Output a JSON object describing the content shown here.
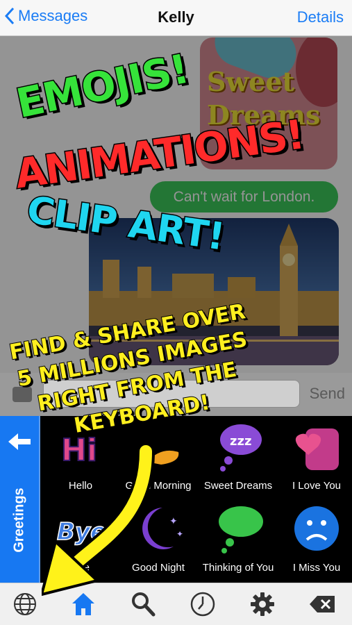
{
  "nav": {
    "back_label": "Messages",
    "title": "Kelly",
    "details_label": "Details"
  },
  "conversation": {
    "image_message_text": "Sweet Dreams",
    "text_message": "Can't wait for London."
  },
  "input_bar": {
    "send_label": "Send"
  },
  "keyboard": {
    "category": "Greetings",
    "tiles": [
      {
        "label": "Hello",
        "art": "Hi"
      },
      {
        "label": "Good Morning",
        "art": ""
      },
      {
        "label": "Sweet Dreams",
        "art": "zzz"
      },
      {
        "label": "I Love You",
        "art": ""
      },
      {
        "label": "Bye",
        "art": "Bye"
      },
      {
        "label": "Good Night",
        "art": ""
      },
      {
        "label": "Thinking of You",
        "art": ""
      },
      {
        "label": "I Miss You",
        "art": ""
      }
    ]
  },
  "toolbar": {
    "icons": [
      "globe-icon",
      "home-icon",
      "search-icon",
      "clock-icon",
      "gear-icon",
      "delete-icon"
    ]
  },
  "promo": {
    "line1": "EMOJIS!",
    "line2": "ANIMATIONS!",
    "line3": "CLIP ART!",
    "line4a": "FIND & SHARE OVER",
    "line4b": "5 MILLIONS IMAGES",
    "line4c": "RIGHT FROM THE",
    "line4d": "KEYBOARD!"
  },
  "colors": {
    "ios_blue": "#1a7cf5",
    "bubble_green": "#3dcb5c",
    "sidebar_blue": "#1778f2",
    "promo_green": "#36e33a",
    "promo_red": "#ff2a2a",
    "promo_cyan": "#1fd6f0",
    "promo_yellow": "#ffef1f"
  }
}
